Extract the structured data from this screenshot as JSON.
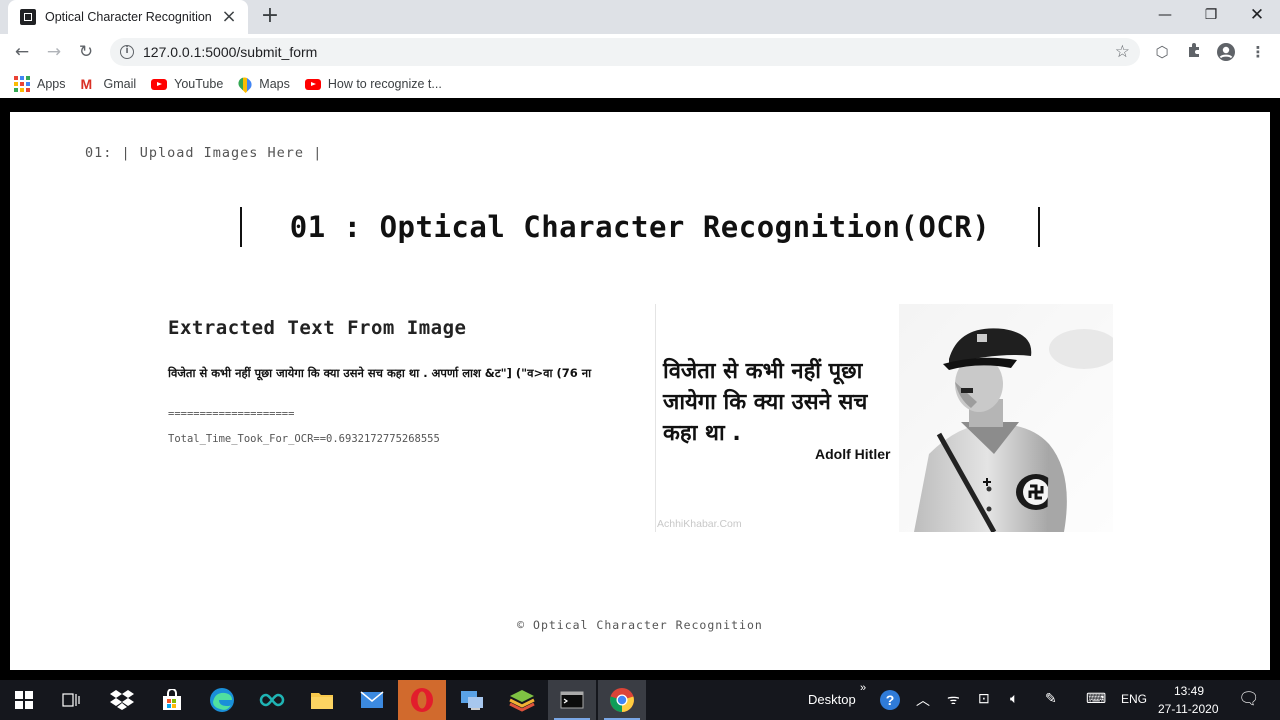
{
  "browser": {
    "tab_title": "Optical Character Recognition",
    "url": "127.0.0.1:5000/submit_form"
  },
  "bookmarks": [
    {
      "label": "Apps",
      "icon": "apps-grid-icon"
    },
    {
      "label": "Gmail",
      "icon": "gmail-icon"
    },
    {
      "label": "YouTube",
      "icon": "youtube-icon"
    },
    {
      "label": "Maps",
      "icon": "maps-icon"
    },
    {
      "label": "How to recognize t...",
      "icon": "youtube-icon"
    }
  ],
  "page": {
    "nav": "01: | Upload Images Here |",
    "heading": "01 : Optical Character Recognition(OCR)",
    "result_heading": "Extracted Text From Image",
    "extracted_text": "विजेता से कभी नहीं पूछा जायेगा कि क्या उसने सच कहा था . अपर्णा लाश &ट\"] (\"व>वा (76 ना",
    "separator": "====================",
    "timing": "Total_Time_Took_For_OCR==0.6932172775268555",
    "footer": "© Optical Character Recognition"
  },
  "image": {
    "quote": "विजेता से कभी नहीं  पूछा जायेगा कि क्या उसने सच कहा था .",
    "author": "Adolf Hitler",
    "watermark": "AchhiKhabar.Com"
  },
  "taskbar": {
    "desktop_label": "Desktop",
    "language": "ENG",
    "time": "13:49",
    "date": "27-11-2020"
  },
  "colors": {
    "tabstrip": "#dee1e6",
    "taskbar": "#15171d",
    "page_bg": "#ffffff",
    "frame": "#000000"
  }
}
